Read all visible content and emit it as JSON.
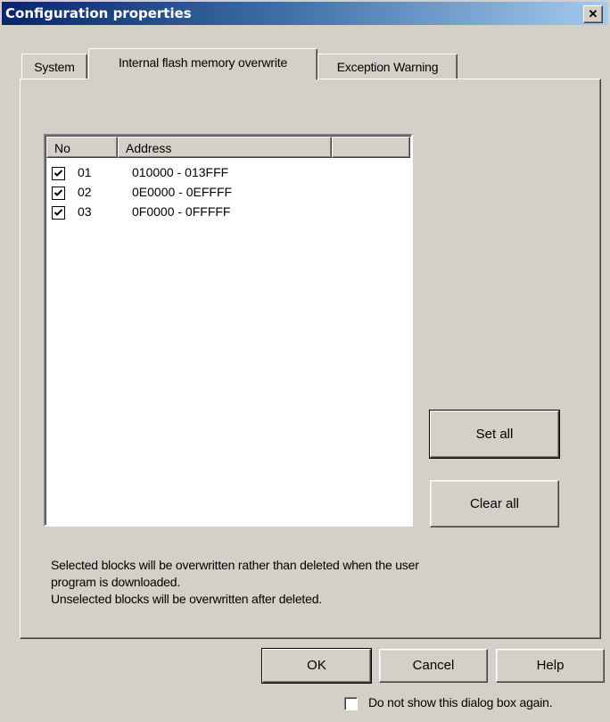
{
  "window": {
    "title": "Configuration properties",
    "close_glyph": "✕"
  },
  "tabs": [
    {
      "label": "System"
    },
    {
      "label": "Internal flash memory overwrite",
      "active": true
    },
    {
      "label": "Exception Warning"
    }
  ],
  "list": {
    "columns": [
      "No",
      "Address",
      ""
    ],
    "rows": [
      {
        "checked": true,
        "no": "01",
        "address": "010000 - 013FFF"
      },
      {
        "checked": true,
        "no": "02",
        "address": "0E0000 - 0EFFFF"
      },
      {
        "checked": true,
        "no": "03",
        "address": "0F0000 - 0FFFFF"
      }
    ]
  },
  "buttons": {
    "set_all": "Set all",
    "clear_all": "Clear all",
    "ok": "OK",
    "cancel": "Cancel",
    "help": "Help"
  },
  "description": {
    "line1": "Selected blocks will be overwritten rather than deleted when the user",
    "line2": "program is downloaded.",
    "line3": "Unselected blocks will be overwritten after deleted."
  },
  "dont_show": {
    "label": "Do not show this dialog box again.",
    "checked": false
  },
  "icons": {
    "close": "close-icon",
    "check": "checkmark-icon"
  },
  "colors": {
    "face": "#d4d0c8",
    "title_start": "#0a246a",
    "title_end": "#a6caf0"
  }
}
